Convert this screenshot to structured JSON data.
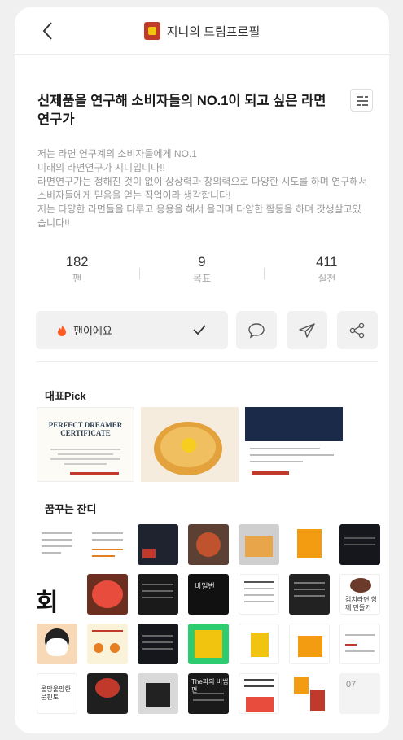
{
  "header": {
    "title": "지니의 드림프로필"
  },
  "headline": "신제품을 연구해 소비자들의 NO.1이 되고 싶은 라면 연구가",
  "description": [
    "저는 라면 연구계의 소비자들에게 NO.1",
    "미래의 라면연구가 지니입니다!!",
    "라면연구가는 정해진 것이 없이 상상력과 창의력으로 다양한 시도를 하며 연구해서 소비자들에게 믿음을 얻는 직업이라 생각합니다!",
    "저는 다양한 라면들을 다루고 응용을 해서 올리며 다양한 활동을 하며 갓생살고있습니다!!"
  ],
  "stats": [
    {
      "value": "182",
      "label": "팬"
    },
    {
      "value": "9",
      "label": "목표"
    },
    {
      "value": "411",
      "label": "실천"
    }
  ],
  "actions": {
    "fan_label": "팬이에요"
  },
  "pick": {
    "title": "대표Pick",
    "cert_title": "PERFECT DREAMER CERTIFICATE"
  },
  "grass": {
    "title": "꿈꾸는 잔디",
    "big_char": "회",
    "cell_texts": {
      "r2c7": "김치라면 함께 만들기",
      "r2c4": "비밀번",
      "r4c4": "The파의 비법편",
      "r4c1": "올망울망한 문핀토",
      "r4c7": "07"
    }
  },
  "colors": {
    "fan_flame": "#ff5a1f",
    "accent_red": "#c0392b"
  }
}
